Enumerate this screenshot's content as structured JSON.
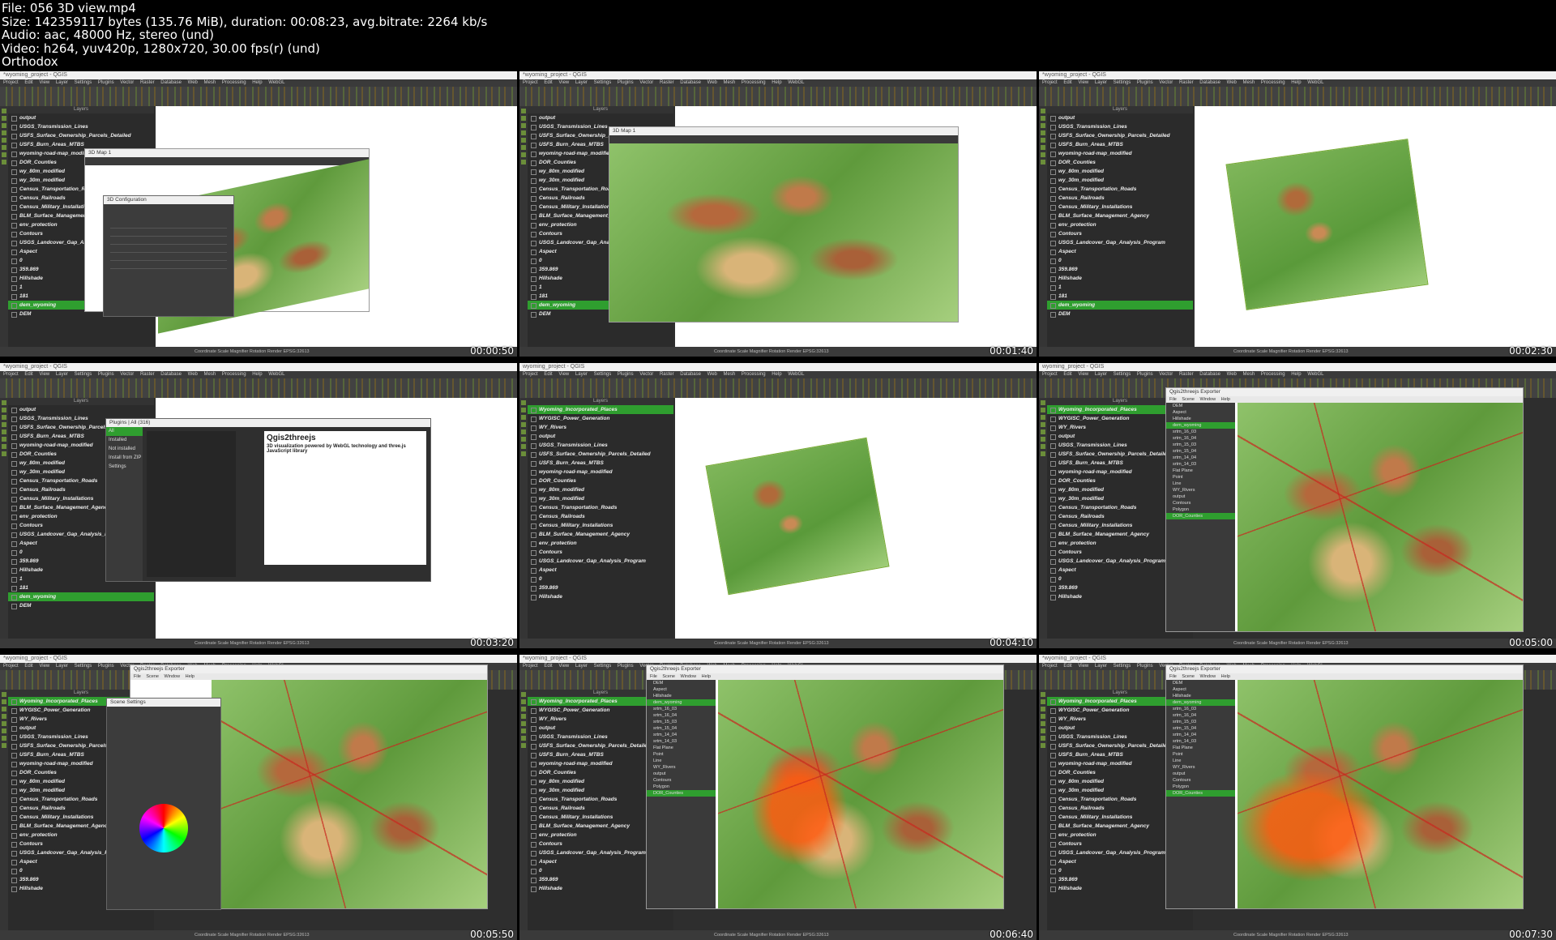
{
  "header": {
    "file": "File: 056 3D view.mp4",
    "size": "Size: 142359117 bytes (135.76 MiB), duration: 00:08:23, avg.bitrate: 2264 kb/s",
    "audio": "Audio: aac, 48000 Hz, stereo (und)",
    "video": "Video: h264, yuv420p, 1280x720, 30.00 fps(r) (und)",
    "author": "Orthodox"
  },
  "app": {
    "title_modified": "*wyoming_project - QGIS",
    "title": "wyoming_project - QGIS",
    "menu": "Project Edit View Layer Settings Plugins Vector Raster Database Web Mesh Processing Help WebGL",
    "layers_header": "Layers",
    "status": "Coordinate  Scale  Magnifier  Rotation  Render  EPSG:32613"
  },
  "layers_a": [
    "output",
    "USGS_Transmission_Lines",
    "USFS_Surface_Ownership_Parcels_Detailed",
    "USFS_Burn_Areas_MTBS",
    "wyoming-road-map_modified",
    "DOR_Counties",
    "wy_80m_modified",
    "wy_30m_modified",
    "Census_Transportation_Roads",
    "Census_Railroads",
    "Census_Military_Installations",
    "BLM_Surface_Management_Agency",
    "env_protection",
    "Contours",
    "USGS_Landcover_Gap_Analysis_Program",
    "Aspect",
    "0",
    "359.869",
    "Hillshade",
    "1",
    "181",
    "dem_wyoming",
    "DEM"
  ],
  "layers_b": [
    "Wyoming_Incorporated_Places",
    "WYGISC_Power_Generation",
    "WY_Rivers",
    "output",
    "USGS_Transmission_Lines",
    "USFS_Surface_Ownership_Parcels_Detailed",
    "USFS_Burn_Areas_MTBS",
    "wyoming-road-map_modified",
    "DOR_Counties",
    "wy_80m_modified",
    "wy_30m_modified",
    "Census_Transportation_Roads",
    "Census_Railroads",
    "Census_Military_Installations",
    "BLM_Surface_Management_Agency",
    "env_protection",
    "Contours",
    "USGS_Landcover_Gap_Analysis_Program",
    "Aspect",
    "0",
    "359.869",
    "Hillshade"
  ],
  "thumbs": [
    {
      "time": "00:00:50",
      "dialog_title": "3D Configuration",
      "window_title": "3D Map 1"
    },
    {
      "time": "00:01:40",
      "window_title": "3D Map 1"
    },
    {
      "time": "00:02:30"
    },
    {
      "time": "00:03:20",
      "dialog_title": "Plugins | All (316)",
      "plugin_name": "Qgis2threejs",
      "plugin_desc": "3D visualization powered by WebGL technology and three.js JavaScript library",
      "plugin_items": [
        "All",
        "Installed",
        "Not installed",
        "Install from ZIP",
        "Settings"
      ]
    },
    {
      "time": "00:04:10"
    },
    {
      "time": "00:05:00",
      "window_title": "Qgis2threejs Exporter"
    },
    {
      "time": "00:05:50",
      "window_title": "Qgis2threejs Exporter",
      "dialog_title": "Scene Settings"
    },
    {
      "time": "00:06:40",
      "window_title": "Qgis2threejs Exporter"
    },
    {
      "time": "00:07:30",
      "window_title": "Qgis2threejs Exporter"
    }
  ],
  "exporter_tree": [
    "DEM",
    "Aspect",
    "Hillshade",
    "dem_wyoming",
    "srtm_16_03",
    "srtm_16_04",
    "srtm_15_03",
    "srtm_15_04",
    "srtm_14_04",
    "srtm_14_03",
    "Flat Plane",
    "Point",
    "Line",
    "WY_Rivers",
    "output",
    "Contours",
    "Polygon",
    "DOR_Counties"
  ],
  "exporter_menu": "File Scene Window Help"
}
